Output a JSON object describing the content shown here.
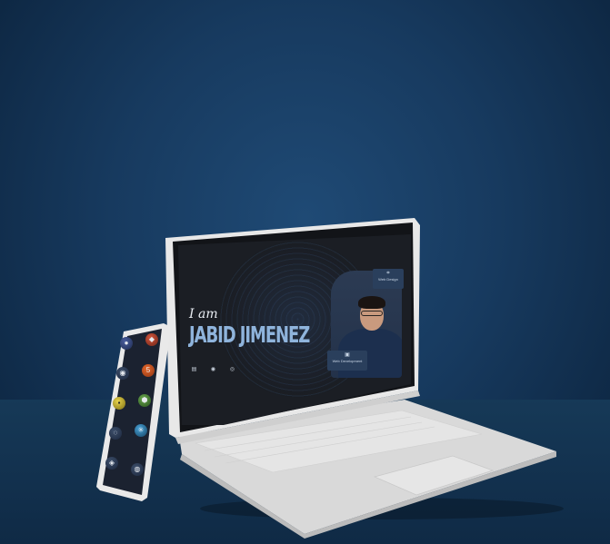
{
  "hero": {
    "intro": "I am",
    "name": "JABID JIMENEZ"
  },
  "skills": {
    "top": "Web Design",
    "bottom": "Web Development"
  },
  "social_icons": [
    "resume-icon",
    "github-icon",
    "whatsapp-icon"
  ],
  "phone_apps": [
    "app-1",
    "app-2",
    "github-app",
    "html5-app",
    "js-app",
    "node-app",
    "app-7",
    "react-app",
    "app-9",
    "app-10"
  ],
  "colors": {
    "background": "#173a5f",
    "screen": "#1b1e24",
    "name_accent": "#8fb4dc",
    "device_body": "#d9d9d9"
  }
}
